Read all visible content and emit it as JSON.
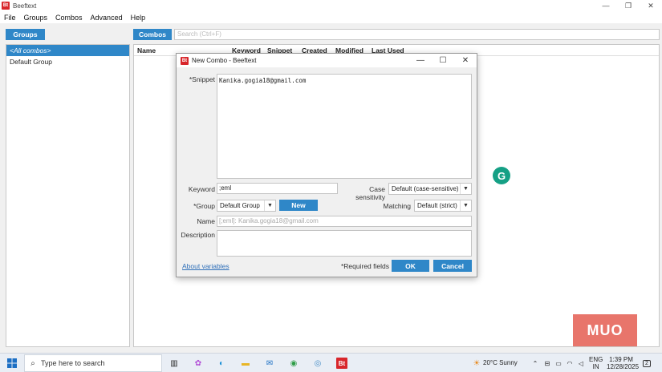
{
  "app": {
    "title": "Beeftext",
    "logo": "Bt"
  },
  "menu": [
    "File",
    "Groups",
    "Combos",
    "Advanced",
    "Help"
  ],
  "toolbar": {
    "groups_label": "Groups",
    "combos_label": "Combos",
    "search_placeholder": "Search (Ctrl+F)"
  },
  "groups": [
    {
      "label": "<All combos>",
      "selected": true
    },
    {
      "label": "Default Group",
      "selected": false
    }
  ],
  "combos_table": {
    "columns": [
      "Name",
      "Keyword",
      "Snippet",
      "Created",
      "Modified",
      "Last Used"
    ]
  },
  "dialog": {
    "title": "New Combo - Beeftext",
    "snippet_label": "Snippet",
    "snippet_value": "Kanika.gogia18@gmail.com",
    "keyword_label": "Keyword",
    "keyword_value": ";eml",
    "case_label": "Case sensitivity",
    "case_value": "Default (case-sensitive)",
    "group_label": "Group",
    "group_value": "Default Group",
    "new_label": "New",
    "matching_label": "Matching",
    "matching_value": "Default (strict)",
    "name_label": "Name",
    "name_placeholder": "[;eml]: Kanika.gogia18@gmail.com",
    "description_label": "Description",
    "description_value": "",
    "about_link": "About variables",
    "required_note": "*Required fields",
    "ok_label": "OK",
    "cancel_label": "Cancel",
    "required_marker": "*"
  },
  "overlay": {
    "grammarly": "G",
    "watermark": "MUO"
  },
  "taskbar": {
    "search_text": "Type here to search",
    "weather": "20°C  Sunny",
    "lang_line1": "ENG",
    "lang_line2": "IN",
    "time": "1:39 PM",
    "date": "12/28/2025",
    "notif_count": "2"
  },
  "colors": {
    "accent": "#2f87c8",
    "brand_red": "#d8262b",
    "link": "#2f6fb8"
  }
}
